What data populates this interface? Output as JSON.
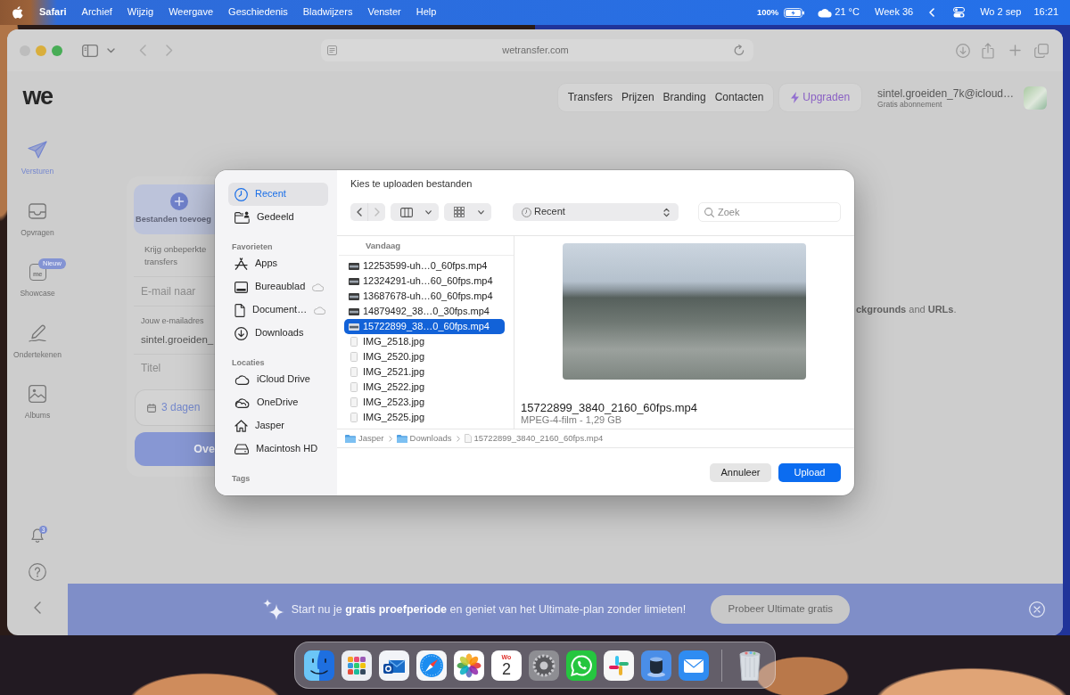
{
  "menu_bar": {
    "app": "Safari",
    "menus": [
      "Archief",
      "Wijzig",
      "Weergave",
      "Geschiedenis",
      "Bladwijzers",
      "Venster",
      "Help"
    ],
    "battery": "100%",
    "temperature": "21 °C",
    "week": "Week 36",
    "date": "Wo 2 sep",
    "time": "16:21"
  },
  "browser": {
    "address": "wetransfer.com"
  },
  "site": {
    "logo": "we",
    "nav": [
      {
        "label": "Versturen",
        "selected": true
      },
      {
        "label": "Opvragen",
        "selected": false
      },
      {
        "label": "Showcase",
        "selected": false,
        "icon_text": "me",
        "badge": "Nieuw"
      },
      {
        "label": "Ondertekenen",
        "selected": false
      },
      {
        "label": "Albums",
        "selected": false
      }
    ],
    "notifications_badge": "3",
    "links": [
      "Transfers",
      "Prijzen",
      "Branding",
      "Contacten"
    ],
    "upgrade": "Upgraden",
    "account": {
      "email": "sintel.groeiden_7k@icloud…",
      "plan": "Gratis abonnement"
    },
    "form": {
      "add_files": "Bestanden toevoeg",
      "promo": "Krijg onbeperkte transfers",
      "email_to": {
        "placeholder": "E-mail naar"
      },
      "your_email": {
        "label": "Jouw e-mailadres",
        "value": "sintel.groeiden_"
      },
      "title": {
        "placeholder": "Titel"
      },
      "expiry": "3 dagen",
      "submit": "Ove"
    },
    "hero": "**ckgrounds** and **URLs**.",
    "banner": {
      "text": "Start nu je **gratis proefperiode** en geniet van het Ultimate-plan zonder limieten!",
      "button": "Probeer Ultimate gratis"
    }
  },
  "dialog": {
    "title": "Kies te uploaden bestanden",
    "sidebar": [
      {
        "items": [
          {
            "label": "Recent",
            "selected": true,
            "in_icloud": false
          },
          {
            "label": "Gedeeld",
            "selected": false,
            "in_icloud": false
          }
        ]
      },
      {
        "header": "Favorieten",
        "items": [
          {
            "label": "Apps",
            "selected": false,
            "in_icloud": false
          },
          {
            "label": "Bureaublad",
            "selected": false,
            "in_icloud": true
          },
          {
            "label": "Document…",
            "selected": false,
            "in_icloud": true
          },
          {
            "label": "Downloads",
            "selected": false,
            "in_icloud": false
          }
        ]
      },
      {
        "header": "Locaties",
        "items": [
          {
            "label": "iCloud Drive",
            "selected": false,
            "in_icloud": false
          },
          {
            "label": "OneDrive",
            "selected": false,
            "in_icloud": false
          },
          {
            "label": "Jasper",
            "selected": false,
            "in_icloud": false
          },
          {
            "label": "Macintosh HD",
            "selected": false,
            "in_icloud": false
          }
        ]
      },
      {
        "header": "Tags"
      }
    ],
    "back_disabled": false,
    "forward_disabled": true,
    "location": "Recent",
    "search": {
      "placeholder": "Zoek"
    },
    "list_header": "Vandaag",
    "files": [
      {
        "kind": "video",
        "name": "12253599-uh…0_60fps.mp4",
        "selected": false
      },
      {
        "kind": "video",
        "name": "12324291-uh…60_60fps.mp4",
        "selected": false
      },
      {
        "kind": "video",
        "name": "13687678-uh…60_60fps.mp4",
        "selected": false
      },
      {
        "kind": "video",
        "name": "14879492_38…0_30fps.mp4",
        "selected": false
      },
      {
        "kind": "video",
        "name": "15722899_38…0_60fps.mp4",
        "selected": true
      },
      {
        "kind": "image",
        "name": "IMG_2518.jpg",
        "selected": false
      },
      {
        "kind": "image",
        "name": "IMG_2520.jpg",
        "selected": false
      },
      {
        "kind": "image",
        "name": "IMG_2521.jpg",
        "selected": false
      },
      {
        "kind": "image",
        "name": "IMG_2522.jpg",
        "selected": false
      },
      {
        "kind": "image",
        "name": "IMG_2523.jpg",
        "selected": false
      },
      {
        "kind": "image",
        "name": "IMG_2525.jpg",
        "selected": false
      }
    ],
    "preview": {
      "name": "15722899_3840_2160_60fps.mp4",
      "info": "MPEG-4-film - 1,29 GB"
    },
    "path": [
      {
        "kind": "folder",
        "label": "Jasper"
      },
      {
        "kind": "folder",
        "label": "Downloads"
      },
      {
        "kind": "file",
        "label": "15722899_3840_2160_60fps.mp4"
      }
    ],
    "buttons": {
      "cancel": "Annuleer",
      "confirm": "Upload"
    }
  },
  "dock": {
    "calendar_day": "Wo",
    "calendar_date": "2"
  }
}
